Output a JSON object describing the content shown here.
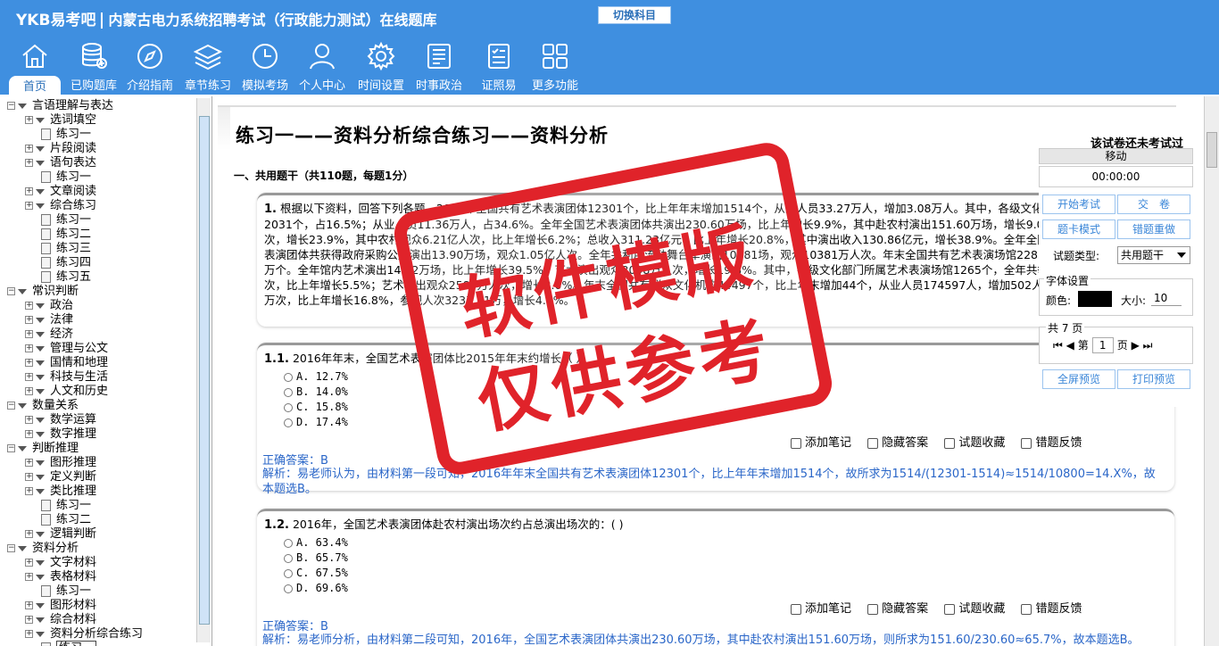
{
  "header": {
    "brand": "YKB易考吧",
    "system_title": "内蒙古电力系统招聘考试（行政能力测试）在线题库",
    "switch_label": "切换科目",
    "nav": [
      {
        "label": "首页",
        "icon": "home-icon"
      },
      {
        "label": "已购题库",
        "icon": "database-icon"
      },
      {
        "label": "介绍指南",
        "icon": "compass-icon"
      },
      {
        "label": "章节练习",
        "icon": "layers-icon"
      },
      {
        "label": "模拟考场",
        "icon": "clock-icon"
      },
      {
        "label": "个人中心",
        "icon": "user-icon"
      },
      {
        "label": "时间设置",
        "icon": "gear-icon"
      },
      {
        "label": "时事政治",
        "icon": "news-icon"
      },
      {
        "label": "证照易",
        "icon": "checklist-icon"
      },
      {
        "label": "更多功能",
        "icon": "grid-icon"
      }
    ]
  },
  "tree": [
    {
      "label": "言语理解与表达",
      "level": 0,
      "kind": "folder"
    },
    {
      "label": "选词填空",
      "level": 1,
      "kind": "folder"
    },
    {
      "label": "练习一",
      "level": 2,
      "kind": "doc"
    },
    {
      "label": "片段阅读",
      "level": 1,
      "kind": "folder"
    },
    {
      "label": "语句表达",
      "level": 1,
      "kind": "folder"
    },
    {
      "label": "练习一",
      "level": 2,
      "kind": "doc"
    },
    {
      "label": "文章阅读",
      "level": 1,
      "kind": "folder"
    },
    {
      "label": "综合练习",
      "level": 1,
      "kind": "folder"
    },
    {
      "label": "练习一",
      "level": 2,
      "kind": "doc"
    },
    {
      "label": "练习二",
      "level": 2,
      "kind": "doc"
    },
    {
      "label": "练习三",
      "level": 2,
      "kind": "doc"
    },
    {
      "label": "练习四",
      "level": 2,
      "kind": "doc"
    },
    {
      "label": "练习五",
      "level": 2,
      "kind": "doc"
    },
    {
      "label": "常识判断",
      "level": 0,
      "kind": "folder"
    },
    {
      "label": "政治",
      "level": 1,
      "kind": "folder"
    },
    {
      "label": "法律",
      "level": 1,
      "kind": "folder"
    },
    {
      "label": "经济",
      "level": 1,
      "kind": "folder"
    },
    {
      "label": "管理与公文",
      "level": 1,
      "kind": "folder"
    },
    {
      "label": "国情和地理",
      "level": 1,
      "kind": "folder"
    },
    {
      "label": "科技与生活",
      "level": 1,
      "kind": "folder"
    },
    {
      "label": "人文和历史",
      "level": 1,
      "kind": "folder"
    },
    {
      "label": "数量关系",
      "level": 0,
      "kind": "folder"
    },
    {
      "label": "数学运算",
      "level": 1,
      "kind": "folder"
    },
    {
      "label": "数字推理",
      "level": 1,
      "kind": "folder"
    },
    {
      "label": "判断推理",
      "level": 0,
      "kind": "folder"
    },
    {
      "label": "图形推理",
      "level": 1,
      "kind": "folder"
    },
    {
      "label": "定义判断",
      "level": 1,
      "kind": "folder"
    },
    {
      "label": "类比推理",
      "level": 1,
      "kind": "folder"
    },
    {
      "label": "练习一",
      "level": 2,
      "kind": "doc"
    },
    {
      "label": "练习二",
      "level": 2,
      "kind": "doc"
    },
    {
      "label": "逻辑判断",
      "level": 1,
      "kind": "folder"
    },
    {
      "label": "资料分析",
      "level": 0,
      "kind": "folder"
    },
    {
      "label": "文字材料",
      "level": 1,
      "kind": "folder"
    },
    {
      "label": "表格材料",
      "level": 1,
      "kind": "folder"
    },
    {
      "label": "练习一",
      "level": 2,
      "kind": "doc"
    },
    {
      "label": "图形材料",
      "level": 1,
      "kind": "folder"
    },
    {
      "label": "综合材料",
      "level": 1,
      "kind": "folder"
    },
    {
      "label": "资料分析综合练习",
      "level": 1,
      "kind": "folder"
    },
    {
      "label": "练习一",
      "level": 2,
      "kind": "doc",
      "selected": true
    }
  ],
  "paper": {
    "title": "练习一——资料分析综合练习——资料分析",
    "status": "该试卷还未考试过",
    "section": "一、共用题干（共110题，每题1分）"
  },
  "stem": {
    "num": "1.",
    "text": "根据以下资料，回答下列各题。2016年全国共有艺术表演团体12301个，比上年年末增加1514个，从业人员33.27万人，增加3.08万人。其中，各级文化部门所属的艺术表演团体2031个，占16.5%；从业人员11.36万人，占34.6%。全年全国艺术表演团体共演出230.60万场，比上年增长9.9%，其中赴农村演出151.60万场，增长9.0%；国内观众11.81亿人次，增长23.9%，其中农村观众6.21亿人次，比上年增长6.2%；总收入311.23亿元，比上年增长20.8%，其中演出收入130.86亿元，增长38.9%。全年全国各级文化部门所属艺术表演团体共获得政府采购公益演出13.90万场，观众1.05亿人次。全年共利用流动舞台车演出10381场，观众10381万人次。年末全国共有艺术表演场馆2285个，观众座席数168.93万个。全年馆内艺术演出14.72万场，比上年增长39.5%；艺术演出观众3098万人次，增长19.8%。其中，各级文化部门所属艺术表演场馆1265个，全年共举行艺术演出6.81万场次，比上年增长5.5%；艺术演出观众2589万人次，增长3.0%。年末全国共有群众文化机构44497个，比上年末增加44个，从业人员174597人，增加502人。全年共举办展览14.76万次，比上年增长16.8%，参观人次3237.21万，增长4.8%。"
  },
  "questions": [
    {
      "num": "1.1.",
      "text": "2016年年末，全国艺术表演团体比2015年年末约增长（ ）",
      "options": [
        "A. 12.7%",
        "B. 14.0%",
        "C. 15.8%",
        "D. 17.4%"
      ],
      "answer_label": "正确答案：",
      "answer": "B",
      "analysis": "解析：易老师认为，由材料第一段可知，2016年年末全国共有艺术表演团体12301个，比上年年末增加1514个，故所求为1514/(12301-1514)≈1514/10800=14.X%，故本题选B。"
    },
    {
      "num": "1.2.",
      "text": "2016年，全国艺术表演团体赴农村演出场次约占总演出场次的：( )",
      "options": [
        "A. 63.4%",
        "B. 65.7%",
        "C. 67.5%",
        "D. 69.6%"
      ],
      "answer_label": "正确答案：",
      "answer": "B",
      "analysis": "解析：易老师分析，由材料第二段可知，2016年，全国艺术表演团体共演出230.60万场，其中赴农村演出151.60万场，则所求为151.60/230.60≈65.7%，故本题选B。"
    }
  ],
  "tools": [
    "添加笔记",
    "隐藏答案",
    "试题收藏",
    "错题反馈"
  ],
  "panel": {
    "move": "移动",
    "timer": "00:00:00",
    "start": "开始考试",
    "submit": "交　卷",
    "card_mode": "题卡模式",
    "redo_wrong": "错题重做",
    "type_label": "试题类型:",
    "type_value": "共用题干",
    "font_setting": "字体设置",
    "color_label": "颜色:",
    "size_label": "大小:",
    "size_value": "10",
    "pages_total": "共 7 页",
    "page_prefix": "第",
    "page_value": "1",
    "page_suffix": "页",
    "fullscreen": "全屏预览",
    "print": "打印预览"
  },
  "watermark": {
    "line1": "软件模版",
    "line2": "仅供参考",
    "color": "#e0232a"
  }
}
